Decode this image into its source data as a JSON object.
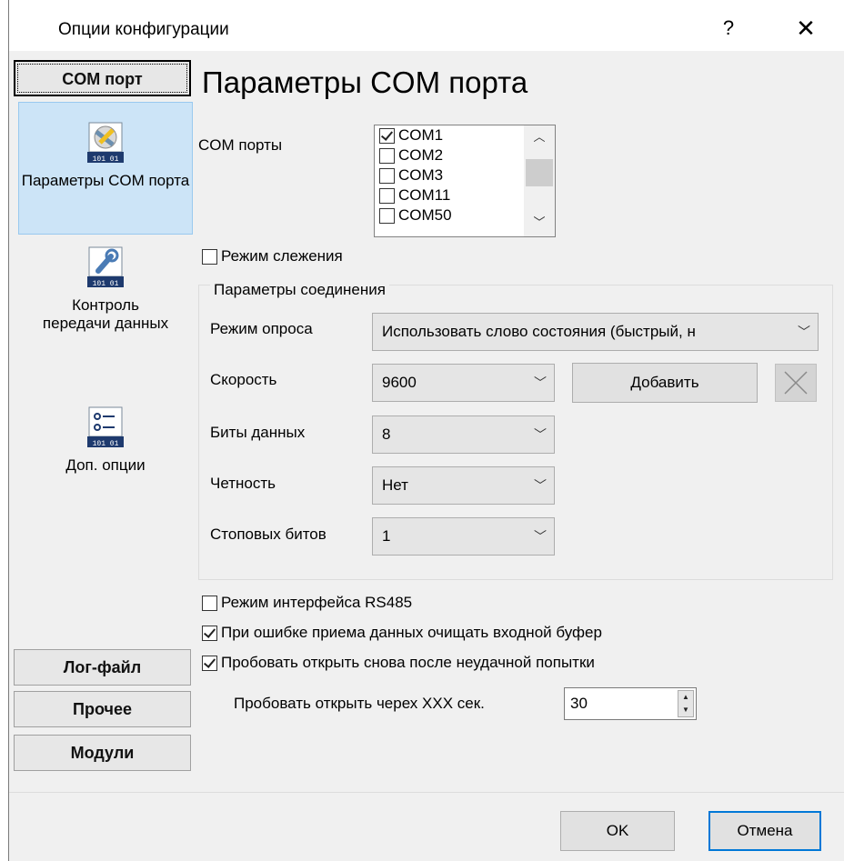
{
  "window": {
    "title": "Опции конфигурации",
    "help": "?",
    "close": "✕"
  },
  "sidebar": {
    "active_category": "COM порт",
    "items": [
      {
        "label": "Параметры COM порта",
        "icon": "serial-port-settings-icon"
      },
      {
        "label": "Контроль передачи данных",
        "icon": "wrench-data-icon"
      },
      {
        "label": "Доп. опции",
        "icon": "options-list-icon"
      }
    ],
    "categories": [
      "Лог-файл",
      "Прочее",
      "Модули"
    ]
  },
  "main": {
    "heading": "Параметры COM порта",
    "com_ports_label": "COM порты",
    "com_ports": [
      {
        "name": "COM1",
        "checked": true
      },
      {
        "name": "COM2",
        "checked": false
      },
      {
        "name": "COM3",
        "checked": false
      },
      {
        "name": "COM11",
        "checked": false
      },
      {
        "name": "COM50",
        "checked": false
      }
    ],
    "monitor_mode": {
      "label": "Режим слежения",
      "checked": false
    },
    "connection": {
      "title": "Параметры соединения",
      "poll_mode_label": "Режим опроса",
      "poll_mode_value": "Использовать слово состояния (быстрый, н",
      "speed_label": "Скорость",
      "speed_value": "9600",
      "add_button": "Добавить",
      "data_bits_label": "Биты данных",
      "data_bits_value": "8",
      "parity_label": "Четность",
      "parity_value": "Нет",
      "stop_bits_label": "Стоповых битов",
      "stop_bits_value": "1"
    },
    "rs485": {
      "label": "Режим интерфейса RS485",
      "checked": false
    },
    "clear_buffer": {
      "label": "При ошибке приема данных очищать входной буфер",
      "checked": true
    },
    "retry_open": {
      "label": "Пробовать открыть снова после неудачной попытки",
      "checked": true
    },
    "retry_interval_label": "Пробовать открыть черех XXX сек.",
    "retry_interval_value": "30"
  },
  "footer": {
    "ok": "OK",
    "cancel": "Отмена"
  }
}
